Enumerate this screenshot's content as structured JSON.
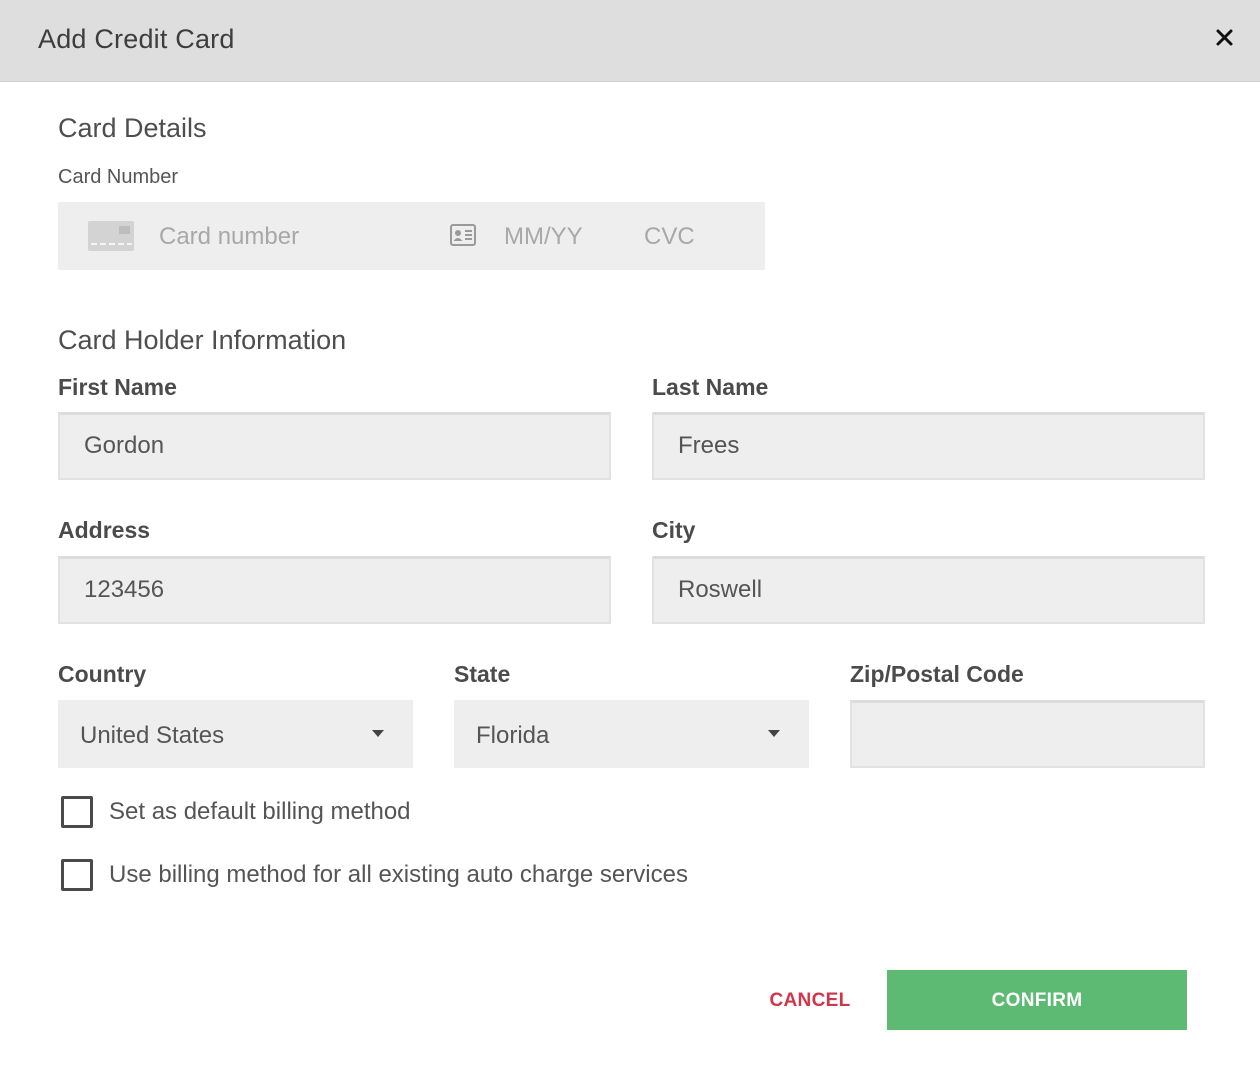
{
  "header": {
    "title": "Add Credit Card",
    "close_icon": "close-icon"
  },
  "card_details": {
    "section_title": "Card Details",
    "card_number_label": "Card Number",
    "card_number_placeholder": "Card number",
    "expiry_placeholder": "MM/YY",
    "cvc_placeholder": "CVC",
    "card_icon": "credit-card-icon",
    "expiry_icon": "id-card-icon"
  },
  "holder": {
    "section_title": "Card Holder Information",
    "first_name": {
      "label": "First Name",
      "value": "Gordon"
    },
    "last_name": {
      "label": "Last Name",
      "value": "Frees"
    },
    "address": {
      "label": "Address",
      "value": "123456"
    },
    "city": {
      "label": "City",
      "value": "Roswell"
    },
    "country": {
      "label": "Country",
      "value": "United States"
    },
    "state": {
      "label": "State",
      "value": "Florida"
    },
    "zip": {
      "label": "Zip/Postal Code",
      "value": ""
    }
  },
  "options": {
    "default_billing": {
      "label": "Set as default billing method",
      "checked": false
    },
    "auto_charge": {
      "label": "Use billing method for all existing auto charge services",
      "checked": false
    }
  },
  "actions": {
    "cancel_label": "CANCEL",
    "confirm_label": "CONFIRM"
  },
  "colors": {
    "header_bg": "#dedede",
    "field_bg": "#eeeeee",
    "cancel_text": "#d0364a",
    "confirm_bg": "#5cba73"
  }
}
